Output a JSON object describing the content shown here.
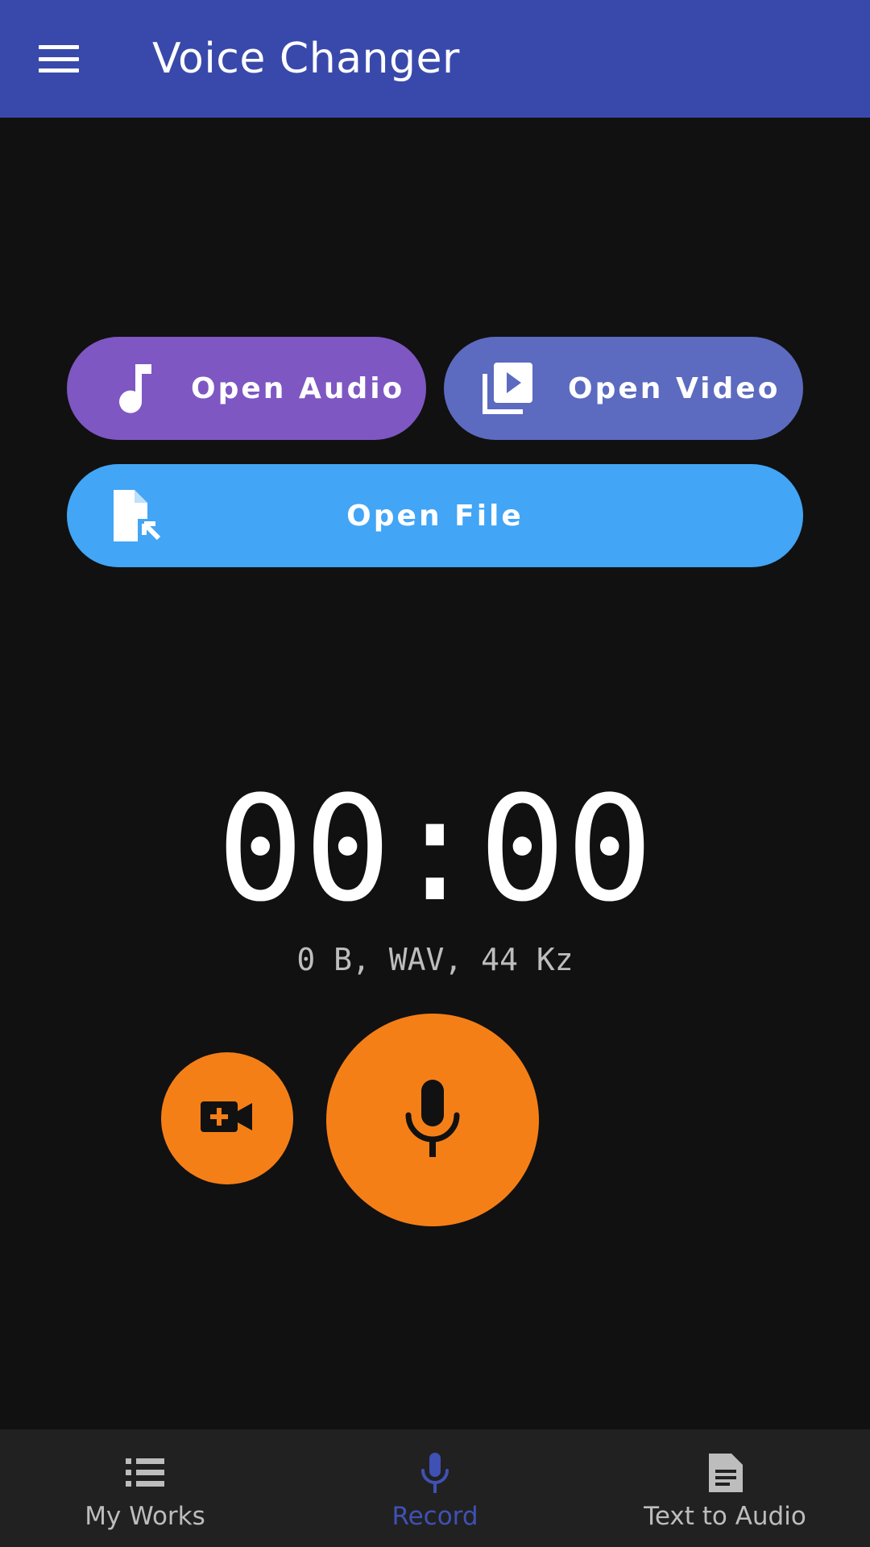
{
  "app_bar": {
    "title": "Voice Changer",
    "menu_icon": "hamburger-menu-icon",
    "background": "#3949ab"
  },
  "actions": {
    "open_audio": {
      "label": "Open Audio",
      "icon": "music-note-icon",
      "color": "#7e57c2"
    },
    "open_video": {
      "label": "Open Video",
      "icon": "video-library-icon",
      "color": "#5c6bc0"
    },
    "open_file": {
      "label": "Open File",
      "icon": "file-open-icon",
      "color": "#42a5f5"
    }
  },
  "recorder": {
    "timer": "00:00",
    "meta": "0 B, WAV, 44 Kz",
    "video_record_icon": "video-add-icon",
    "mic_icon": "microphone-icon",
    "accent": "#f57f17"
  },
  "bottom_nav": {
    "items": [
      {
        "label": "My Works",
        "icon": "list-icon",
        "active": false
      },
      {
        "label": "Record",
        "icon": "microphone-icon",
        "active": true
      },
      {
        "label": "Text to Audio",
        "icon": "document-icon",
        "active": false
      }
    ],
    "active_color": "#3f51b5"
  }
}
